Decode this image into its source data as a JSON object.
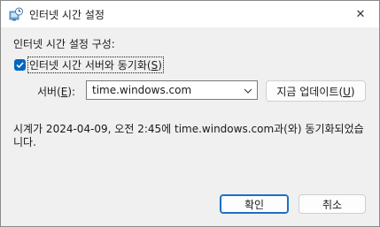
{
  "window": {
    "title": "인터넷 시간 설정",
    "close_label": "✕"
  },
  "section_title": "인터넷 시간 설정 구성:",
  "sync_checkbox": {
    "label": "인터넷 시간 서버와 동기화",
    "mnemonic": "S",
    "checked": true
  },
  "server": {
    "label": "서버",
    "mnemonic": "E",
    "value": "time.windows.com"
  },
  "update_button": {
    "label": "지금 업데이트",
    "mnemonic": "U"
  },
  "status": {
    "line1": "시계가 2024-04-09, 오전 2:45에 time.windows.com과(와) 동기화되었습",
    "line2": "니다."
  },
  "ok_button": {
    "label": "확인"
  },
  "cancel_button": {
    "label": "취소"
  },
  "colors": {
    "accent": "#0067c0",
    "default_border": "#1a6fc4"
  }
}
